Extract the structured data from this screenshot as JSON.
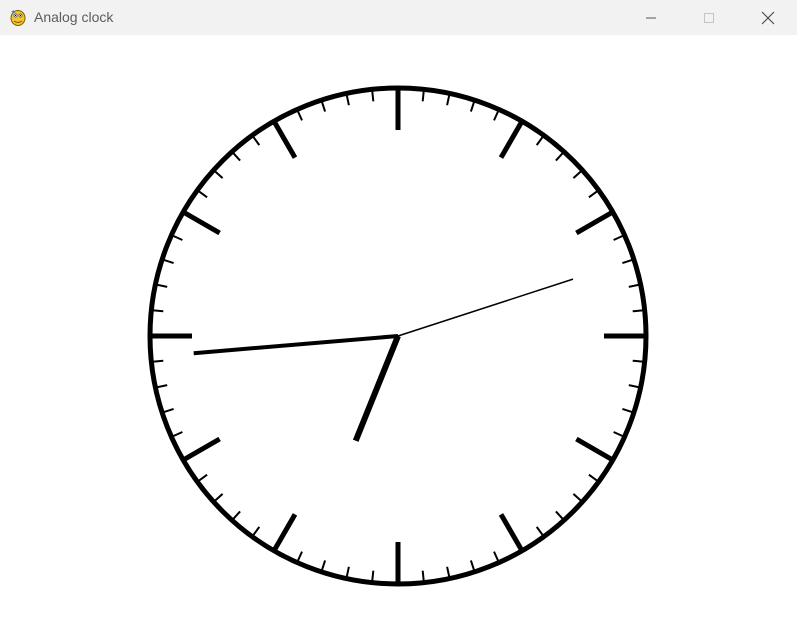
{
  "window": {
    "title": "Analog clock",
    "app_icon": "python-snake-icon",
    "controls": {
      "minimize_icon": "minimize-icon",
      "maximize_icon": "maximize-icon",
      "close_icon": "close-icon",
      "maximize_enabled": false
    }
  },
  "clock": {
    "face_color": "#ffffff",
    "stroke_color": "#000000",
    "time": {
      "hour": 6,
      "minute": 44,
      "second": 12
    },
    "major_ticks": 12,
    "minor_ticks": 60
  }
}
